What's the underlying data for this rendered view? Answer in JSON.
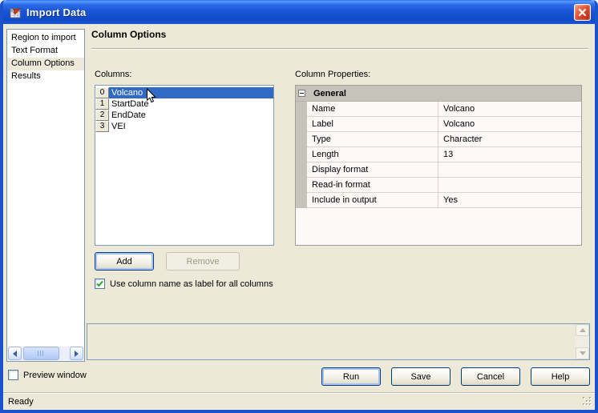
{
  "window": {
    "title": "Import Data"
  },
  "sidebar": {
    "items": [
      {
        "label": "Region to import",
        "selected": false
      },
      {
        "label": "Text Format",
        "selected": false
      },
      {
        "label": "Column Options",
        "selected": true
      },
      {
        "label": "Results",
        "selected": false
      }
    ]
  },
  "page": {
    "heading": "Column Options"
  },
  "columns_section": {
    "label": "Columns:",
    "items": [
      {
        "index": "0",
        "name": "Volcano",
        "selected": true
      },
      {
        "index": "1",
        "name": "StartDate",
        "selected": false
      },
      {
        "index": "2",
        "name": "EndDate",
        "selected": false
      },
      {
        "index": "3",
        "name": "VEI",
        "selected": false
      }
    ],
    "add_button": "Add",
    "remove_button": "Remove",
    "remove_disabled": true,
    "checkbox_label": "Use column name as label for all columns",
    "checkbox_checked": true
  },
  "properties_section": {
    "label": "Column Properties:",
    "group": "General",
    "rows": [
      {
        "name": "Name",
        "value": "Volcano"
      },
      {
        "name": "Label",
        "value": "Volcano"
      },
      {
        "name": "Type",
        "value": "Character"
      },
      {
        "name": "Length",
        "value": "13"
      },
      {
        "name": "Display format",
        "value": ""
      },
      {
        "name": "Read-in format",
        "value": ""
      },
      {
        "name": "Include in output",
        "value": "Yes"
      }
    ]
  },
  "footer": {
    "preview_checkbox_label": "Preview window",
    "preview_checked": false,
    "buttons": [
      {
        "label": "Run",
        "focused": true
      },
      {
        "label": "Save",
        "focused": false
      },
      {
        "label": "Cancel",
        "focused": false
      },
      {
        "label": "Help",
        "focused": false
      }
    ]
  },
  "statusbar": {
    "text": "Ready"
  },
  "icons": {
    "app": "import-data-app-icon",
    "close": "close-x-icon",
    "collapse": "minus-collapse-icon",
    "cursor": "arrow-cursor",
    "scroll": [
      "chevron-left",
      "chevron-right",
      "chevron-up",
      "chevron-down"
    ]
  },
  "colors": {
    "selection_blue": "#316AC5",
    "client_beige": "#ECE9D8",
    "titlebar_blue": "#1A55D8",
    "control_border": "#7F9DB9",
    "grid_header_gray": "#C6C3BB",
    "disabled_text": "#9D9A87",
    "check_green": "#2DA12D",
    "close_red": "#C03315"
  }
}
